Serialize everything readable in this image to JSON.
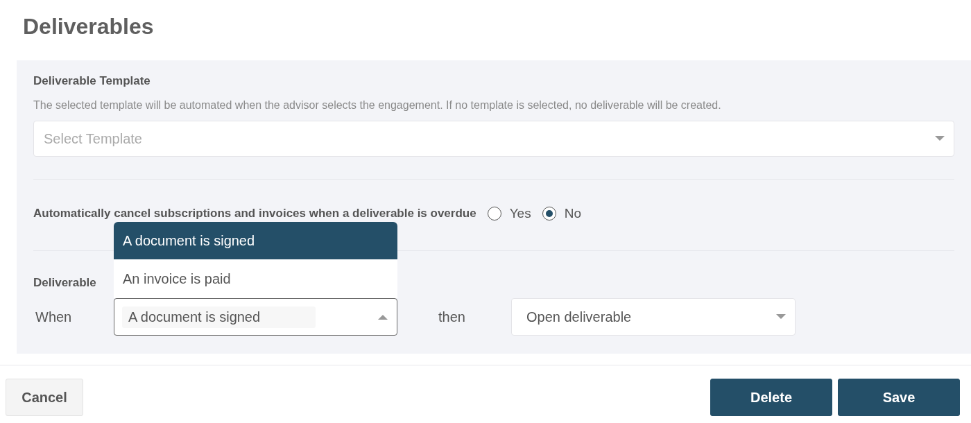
{
  "page": {
    "title": "Deliverables"
  },
  "template": {
    "label": "Deliverable Template",
    "description": "The selected template will be automated when the advisor selects the engagement. If no template is selected, no deliverable will be created.",
    "select": {
      "placeholder": "Select Template"
    }
  },
  "auto_cancel": {
    "label": "Automatically cancel subscriptions and invoices when a deliverable is overdue",
    "options": [
      {
        "label": "Yes",
        "selected": false
      },
      {
        "label": "No",
        "selected": true
      }
    ]
  },
  "trigger": {
    "label": "Deliverable",
    "when_label": "When",
    "when_select": {
      "value": "A document is signed",
      "expanded": true,
      "options": [
        {
          "label": "A document is signed",
          "selected": true
        },
        {
          "label": "An invoice is paid",
          "selected": false
        }
      ]
    },
    "then_label": "then",
    "then_select": {
      "value": "Open deliverable"
    }
  },
  "footer": {
    "cancel": "Cancel",
    "delete": "Delete",
    "save": "Save"
  }
}
